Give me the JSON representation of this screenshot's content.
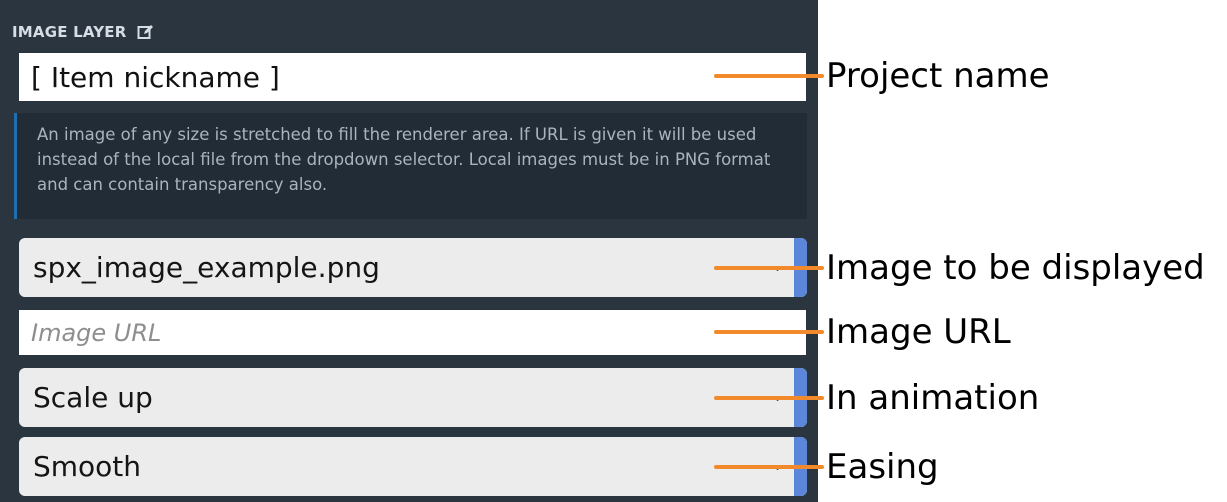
{
  "panel": {
    "header": "IMAGE LAYER",
    "header_icon": "edit-icon",
    "nickname_value": "[ Item nickname ]",
    "info_text": "An image of any size is stretched to fill the renderer area. If URL is given it will be used instead of the local file from the dropdown selector. Local images must be in PNG format and can contain transparency also.",
    "image_select_value": "spx_image_example.png",
    "image_url_placeholder": "Image URL",
    "in_animation_value": "Scale up",
    "easing_value": "Smooth",
    "chevron_icon": "chevron-down-icon"
  },
  "callouts": {
    "project_name": "Project name",
    "image_to_be_displayed": "Image to be displayed",
    "image_url": "Image URL",
    "in_animation": "In animation",
    "easing": "Easing"
  },
  "colors": {
    "panel_bg": "#2b3540",
    "info_bg": "#222c36",
    "info_border": "#1d6fae",
    "select_bg": "#ececec",
    "select_handle": "#5b86d9",
    "callout_line": "#f28a2c"
  }
}
